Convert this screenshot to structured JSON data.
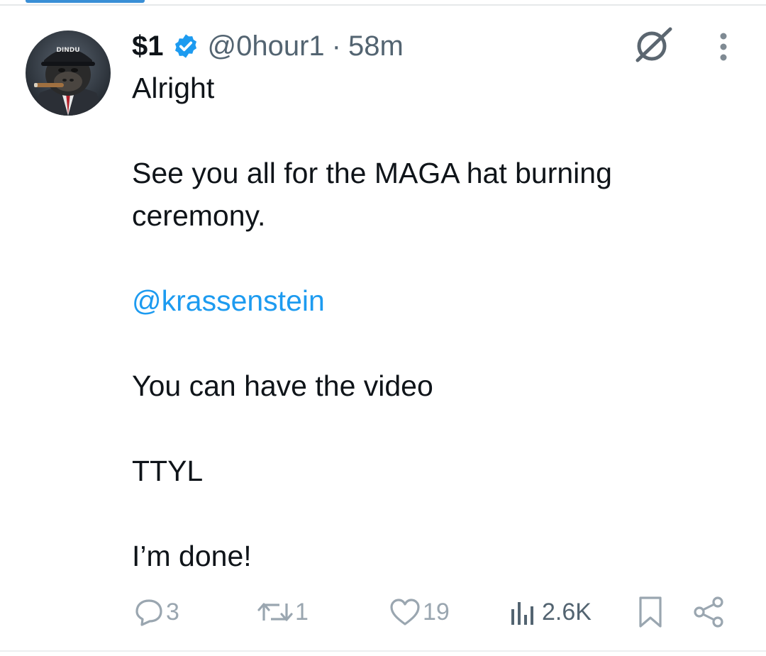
{
  "tweet": {
    "author": {
      "display_name": "$1",
      "handle": "@0hour1",
      "verified": true,
      "avatar_caption": "DINDU"
    },
    "separator": "·",
    "time": "58m",
    "lines": [
      "Alright",
      "See you all for the MAGA hat burning",
      "ceremony.",
      "@krassenstein",
      "You can have the video",
      "TTYL",
      "I’m done!"
    ],
    "actions": {
      "replies": "3",
      "reposts": "1",
      "likes": "19",
      "views": "2.6K"
    }
  },
  "icons": {
    "verified": "verified-badge-icon",
    "mute": "mute-slash-circle-icon",
    "more": "vertical-dots-icon",
    "reply": "reply-bubble-icon",
    "repost": "repost-arrows-icon",
    "like": "heart-icon",
    "views": "views-bars-icon",
    "bookmark": "bookmark-icon",
    "share": "share-nodes-icon"
  },
  "colors": {
    "text": "#0f1419",
    "secondary": "#536471",
    "accent": "#1d9bf0",
    "action_gray": "#9aa6b0"
  }
}
